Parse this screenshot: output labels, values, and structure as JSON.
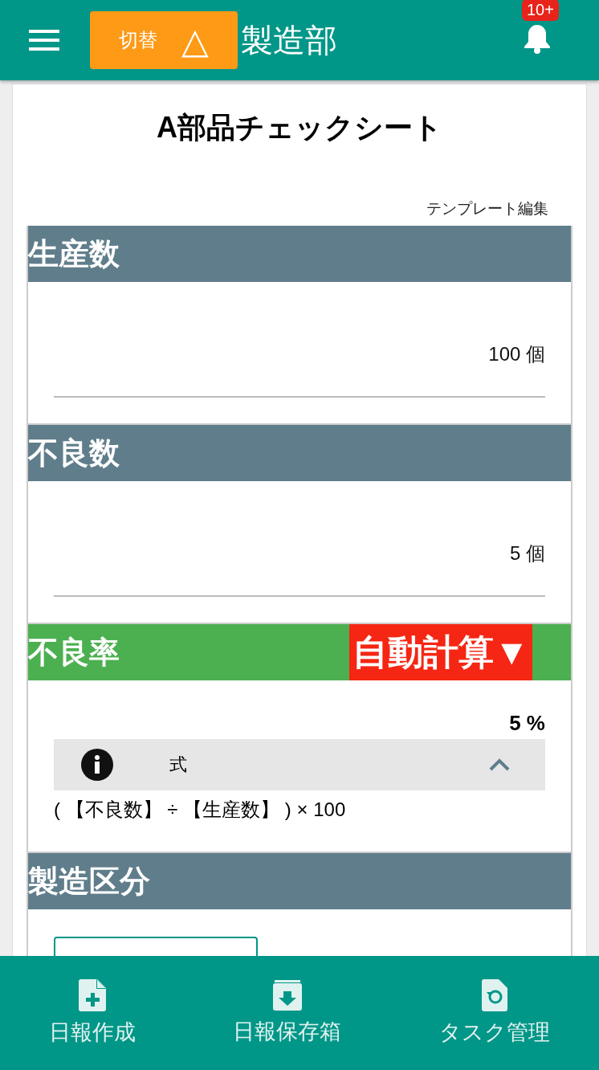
{
  "header": {
    "switch_button": {
      "label": "切替",
      "icon": "△"
    },
    "title": "製造部",
    "notification_badge": "10+"
  },
  "sheet": {
    "title": "A部品チェックシート",
    "template_link": "テンプレート編集",
    "sections": [
      {
        "kind": "input",
        "title": "生産数",
        "value": "100 個"
      },
      {
        "kind": "input",
        "title": "不良数",
        "value": "5 個"
      },
      {
        "kind": "calc",
        "title": "不良率",
        "badge": "自動計算▼",
        "value": "5 %",
        "formula": {
          "label": "式",
          "expanded": true,
          "text": "( 【不良数】 ÷ 【生産数】 ) × 100"
        }
      },
      {
        "kind": "mode",
        "title": "製造区分"
      }
    ]
  },
  "bottom_nav": [
    {
      "kind": "create",
      "label": "日報作成"
    },
    {
      "kind": "archive",
      "label": "日報保存箱"
    },
    {
      "kind": "task",
      "label": "タスク管理"
    }
  ]
}
